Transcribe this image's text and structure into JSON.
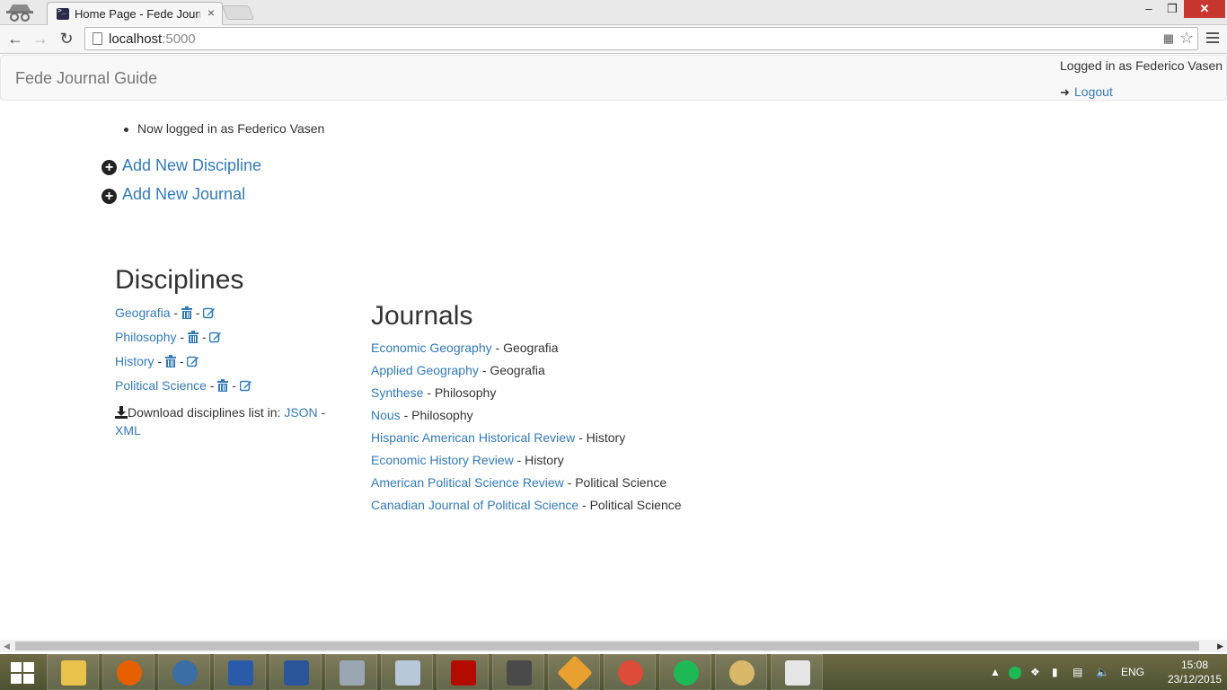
{
  "browser": {
    "tab_title": "Home Page - Fede Journal",
    "tab_close": "×",
    "url_host": "localhost",
    "url_port": ":5000",
    "window_controls": {
      "minimize": "–",
      "maximize": "❐",
      "close": "✕"
    }
  },
  "navbar": {
    "brand": "Fede Journal Guide",
    "logged_in_text": "Logged in as Federico Vasen",
    "logout_label": "Logout"
  },
  "flash_message": "Now logged in as Federico Vasen",
  "actions": {
    "add_discipline": "Add New Discipline",
    "add_journal": "Add New Journal"
  },
  "disciplines": {
    "title": "Disciplines",
    "items": [
      {
        "name": "Geografia"
      },
      {
        "name": "Philosophy"
      },
      {
        "name": "History"
      },
      {
        "name": "Political Science"
      }
    ],
    "download_text": "Download disciplines list in:",
    "download_json": "JSON",
    "download_sep": " -",
    "download_xml": "XML"
  },
  "journals": {
    "title": "Journals",
    "items": [
      {
        "name": "Economic Geography",
        "discipline": "Geografia"
      },
      {
        "name": "Applied Geography",
        "discipline": "Geografia"
      },
      {
        "name": "Synthese",
        "discipline": "Philosophy"
      },
      {
        "name": "Nous",
        "discipline": "Philosophy"
      },
      {
        "name": "Hispanic American Historical Review",
        "discipline": "History"
      },
      {
        "name": "Economic History Review",
        "discipline": "History"
      },
      {
        "name": "American Political Science Review",
        "discipline": "Political Science"
      },
      {
        "name": "Canadian Journal of Political Science",
        "discipline": "Political Science"
      }
    ]
  },
  "taskbar": {
    "language": "ENG",
    "time": "15:08",
    "date": "23/12/2015"
  },
  "colors": {
    "link": "#337ab7",
    "close_button": "#c7372f"
  }
}
